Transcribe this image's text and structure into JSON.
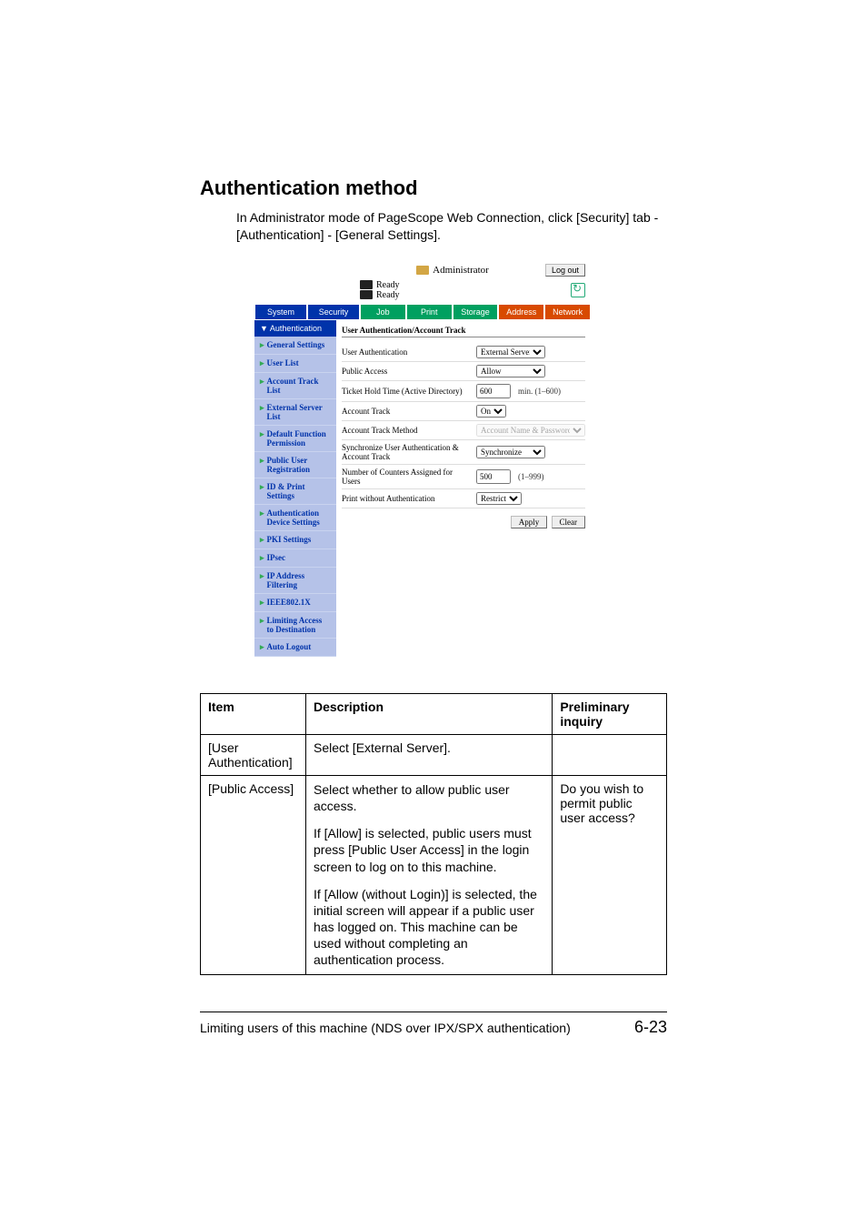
{
  "heading": "Authentication method",
  "intro": "In Administrator mode of PageScope Web Connection, click [Security] tab - [Authentication] - [General Settings].",
  "shot": {
    "administrator": "Administrator",
    "logout": "Log out",
    "ready1": "Ready",
    "ready2": "Ready",
    "tabs_left": [
      "System",
      "Security"
    ],
    "tabs_right": [
      "Job",
      "Print",
      "Storage",
      "Address",
      "Network"
    ],
    "side_header": "▼ Authentication",
    "side_items": [
      "General Settings",
      "User List",
      "Account Track List",
      "External Server List",
      "Default Function Permission",
      "Public User Registration",
      "ID & Print Settings",
      "Authentication Device Settings",
      "PKI Settings",
      "IPsec",
      "IP Address Filtering",
      "IEEE802.1X",
      "Limiting Access to Destination",
      "Auto Logout"
    ],
    "main_title": "User Authentication/Account Track",
    "rows": {
      "user_auth_lbl": "User Authentication",
      "user_auth_val": "External Server",
      "public_access_lbl": "Public Access",
      "public_access_val": "Allow",
      "ticket_lbl": "Ticket Hold Time (Active Directory)",
      "ticket_val": "600",
      "ticket_range": "min. (1–600)",
      "account_track_lbl": "Account Track",
      "account_track_val": "On",
      "atm_lbl": "Account Track Method",
      "atm_val": "Account Name & Password",
      "sync_lbl": "Synchronize User Authentication & Account Track",
      "sync_val": "Synchronize",
      "counters_lbl": "Number of Counters Assigned for Users",
      "counters_val": "500",
      "counters_range": "(1–999)",
      "pwa_lbl": "Print without Authentication",
      "pwa_val": "Restrict"
    },
    "apply": "Apply",
    "clear": "Clear"
  },
  "table": {
    "h1": "Item",
    "h2": "Description",
    "h3": "Preliminary inquiry",
    "r1c1": "[User Authentication]",
    "r1c2": "Select [External Server].",
    "r1c3": "",
    "r2c1": "[Public Access]",
    "r2c2a": "Select whether to allow public user access.",
    "r2c2b": "If [Allow] is selected, public users must press [Public User Access] in the login screen to log on to this machine.",
    "r2c2c": "If [Allow (without Login)] is selected, the initial screen will appear if a public user has logged on. This machine can be used without completing an authentication process.",
    "r2c3": "Do you wish to permit public user access?"
  },
  "footer_text": "Limiting users of this machine (NDS over IPX/SPX authentication)",
  "footer_page": "6-23"
}
